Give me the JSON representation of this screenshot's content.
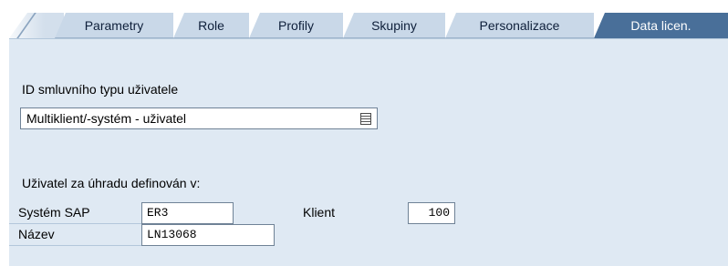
{
  "tabs": [
    {
      "label": "Parametry",
      "active": false
    },
    {
      "label": "Role",
      "active": false
    },
    {
      "label": "Profily",
      "active": false
    },
    {
      "label": "Skupiny",
      "active": false
    },
    {
      "label": "Personalizace",
      "active": false
    },
    {
      "label": "Data licen.",
      "active": true
    }
  ],
  "contract": {
    "section_label": "ID smluvního typu uživatele",
    "selected_value": "Multiklient/-systém - uživatel"
  },
  "billing": {
    "section_label": "Uživatel za úhradu definován v:",
    "system_label": "Systém SAP",
    "system_value": "ER3",
    "client_label": "Klient",
    "client_value": "100",
    "name_label": "Název",
    "name_value": "LN13068"
  },
  "colors": {
    "tab_inactive": "#c9d8e8",
    "tab_active": "#496f99",
    "panel_background": "#dfe9f3"
  },
  "icons": {
    "dropdown": "dropdown-list-icon"
  }
}
